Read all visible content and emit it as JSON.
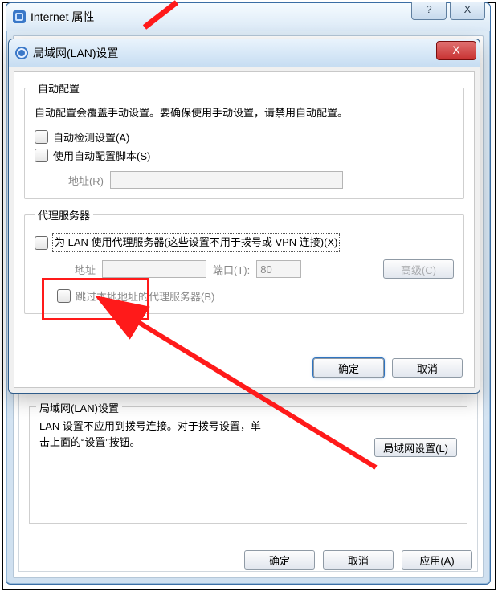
{
  "outer": {
    "title": "Internet 属性",
    "help_glyph": "?",
    "close_glyph": "X"
  },
  "dlg": {
    "title": "局域网(LAN)设置",
    "close_glyph": "X"
  },
  "auto": {
    "legend": "自动配置",
    "desc": "自动配置会覆盖手动设置。要确保使用手动设置，请禁用自动配置。",
    "detect_label": "自动检测设置(A)",
    "script_label": "使用自动配置脚本(S)",
    "addr_label": "地址(R)",
    "addr_value": ""
  },
  "proxy": {
    "legend": "代理服务器",
    "use_label": "为 LAN 使用代理服务器(这些设置不用于拨号或 VPN 连接)(X)",
    "addr_label": "地址",
    "addr_value": "",
    "port_label": "端口(T):",
    "port_value": "80",
    "advanced_label": "高级(C)",
    "bypass_label": "跳过本地地址的代理服务器(B)"
  },
  "dlg_buttons": {
    "ok": "确定",
    "cancel": "取消"
  },
  "lan_section": {
    "legend": "局域网(LAN)设置",
    "desc": "LAN 设置不应用到拨号连接。对于拨号设置，单击上面的“设置”按钮。",
    "button": "局域网设置(L)"
  },
  "outer_buttons": {
    "ok": "确定",
    "cancel": "取消",
    "apply": "应用(A)"
  }
}
